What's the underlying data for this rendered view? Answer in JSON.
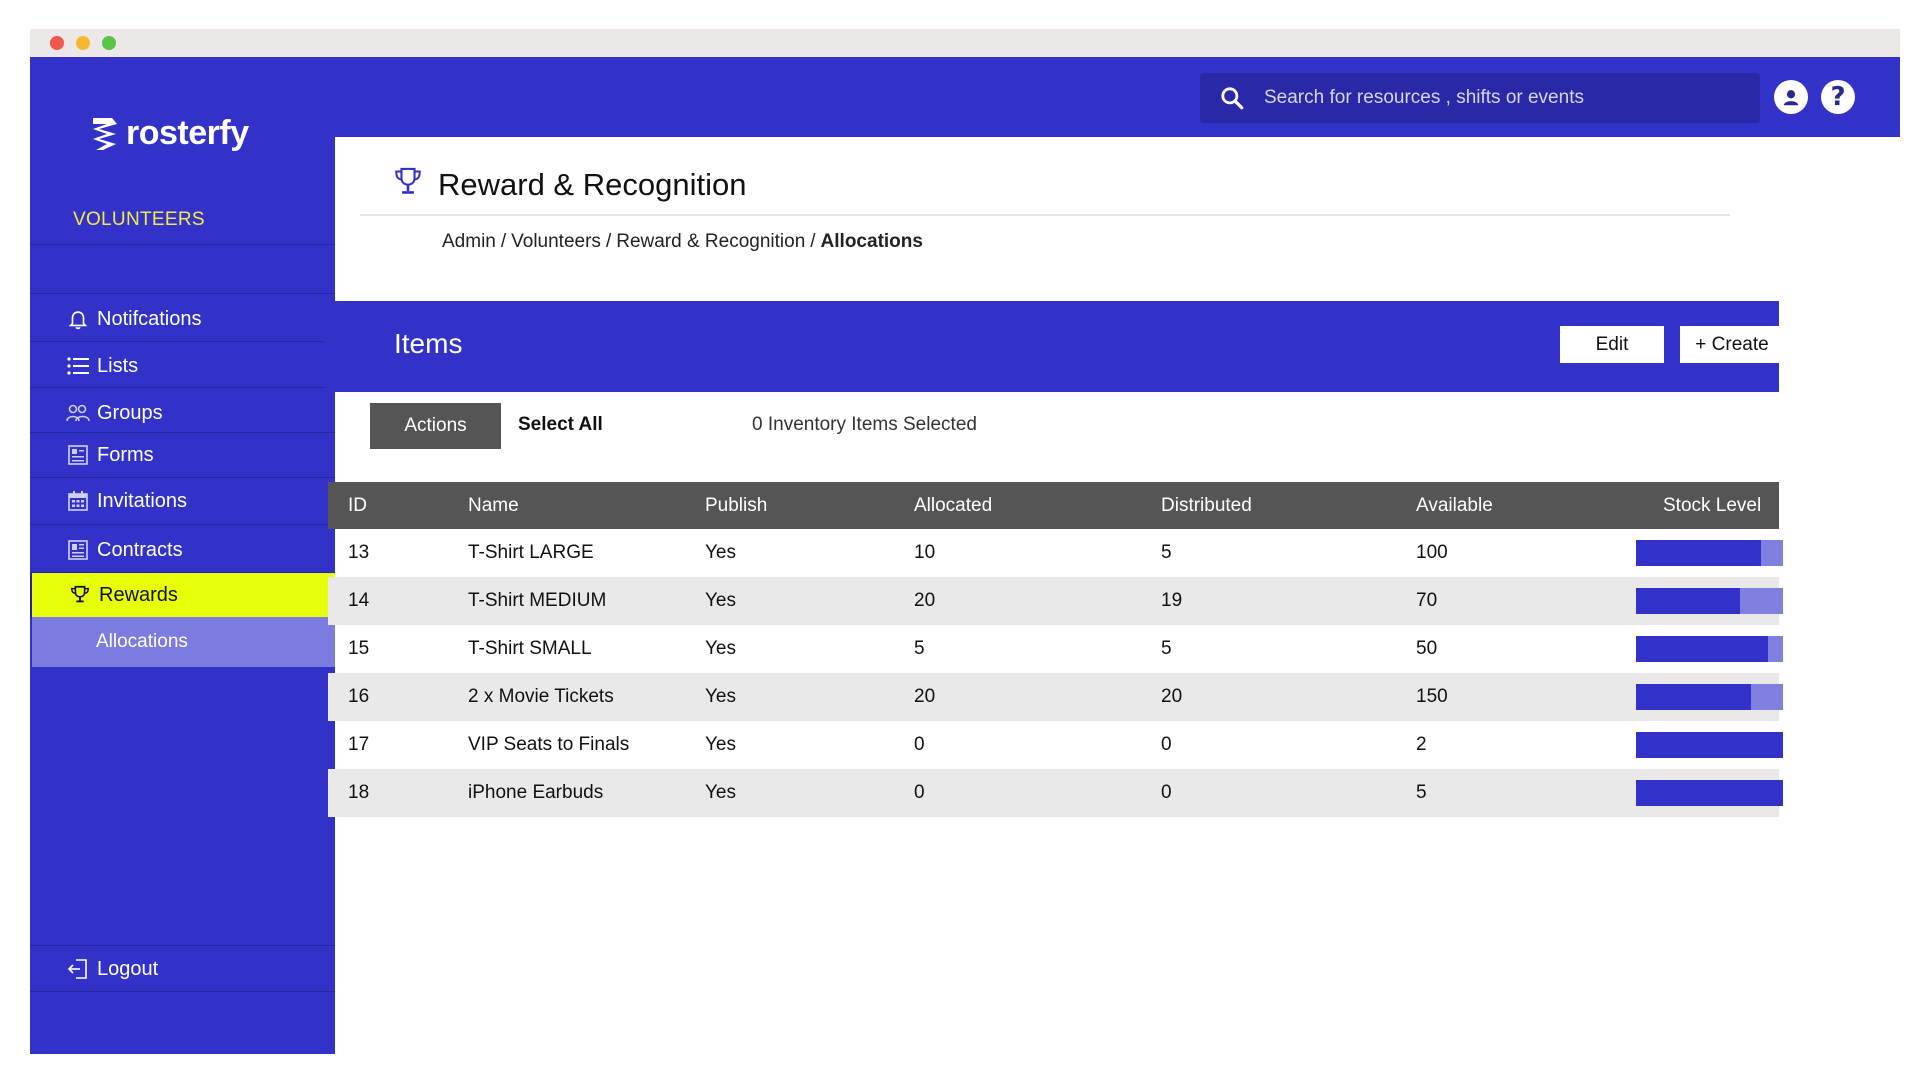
{
  "app": {
    "logo_text": "rosterfy"
  },
  "sidebar": {
    "section": "VOLUNTEERS",
    "items": [
      {
        "label": "Notifcations",
        "icon": "bell-icon"
      },
      {
        "label": "Lists",
        "icon": "list-icon"
      },
      {
        "label": "Groups",
        "icon": "users-icon"
      },
      {
        "label": "Forms",
        "icon": "form-icon"
      },
      {
        "label": "Invitations",
        "icon": "calendar-icon"
      },
      {
        "label": "Contracts",
        "icon": "contract-icon"
      },
      {
        "label": "Rewards",
        "icon": "trophy-icon",
        "active": true
      }
    ],
    "sub_item": "Allocations",
    "logout": "Logout"
  },
  "topbar": {
    "search_placeholder": "Search for resources , shifts or events",
    "icons": [
      "user-icon",
      "help-icon"
    ]
  },
  "page": {
    "title": "Reward & Recognition",
    "breadcrumb": [
      "Admin",
      "Volunteers",
      "Reward & Recognition",
      "Allocations"
    ]
  },
  "items_panel": {
    "title": "Items",
    "edit_label": "Edit",
    "create_label": "+ Create",
    "actions_label": "Actions",
    "select_all_label": "Select All",
    "selected_text": "0 Inventory Items Selected"
  },
  "table": {
    "columns": [
      "ID",
      "Name",
      "Publish",
      "Allocated",
      "Distributed",
      "Available",
      "Stock Level"
    ],
    "rows": [
      {
        "id": "13",
        "name": "T-Shirt LARGE",
        "publish": "Yes",
        "allocated": "10",
        "distributed": "5",
        "available": "100",
        "stock_level": 0.85
      },
      {
        "id": "14",
        "name": "T-Shirt MEDIUM",
        "publish": "Yes",
        "allocated": "20",
        "distributed": "19",
        "available": "70",
        "stock_level": 0.71
      },
      {
        "id": "15",
        "name": "T-Shirt SMALL",
        "publish": "Yes",
        "allocated": "5",
        "distributed": "5",
        "available": "50",
        "stock_level": 0.9
      },
      {
        "id": "16",
        "name": "2 x Movie Tickets",
        "publish": "Yes",
        "allocated": "20",
        "distributed": "20",
        "available": "150",
        "stock_level": 0.78
      },
      {
        "id": "17",
        "name": "VIP Seats to Finals",
        "publish": "Yes",
        "allocated": "0",
        "distributed": "0",
        "available": "2",
        "stock_level": 1.0
      },
      {
        "id": "18",
        "name": "iPhone Earbuds",
        "publish": "Yes",
        "allocated": "0",
        "distributed": "0",
        "available": "5",
        "stock_level": 1.0
      }
    ]
  },
  "colors": {
    "brand": "#3232c8",
    "active": "#e8ff0a",
    "sub_active": "#7b7be0",
    "section_label": "#f4e94a",
    "table_header": "#555555"
  }
}
